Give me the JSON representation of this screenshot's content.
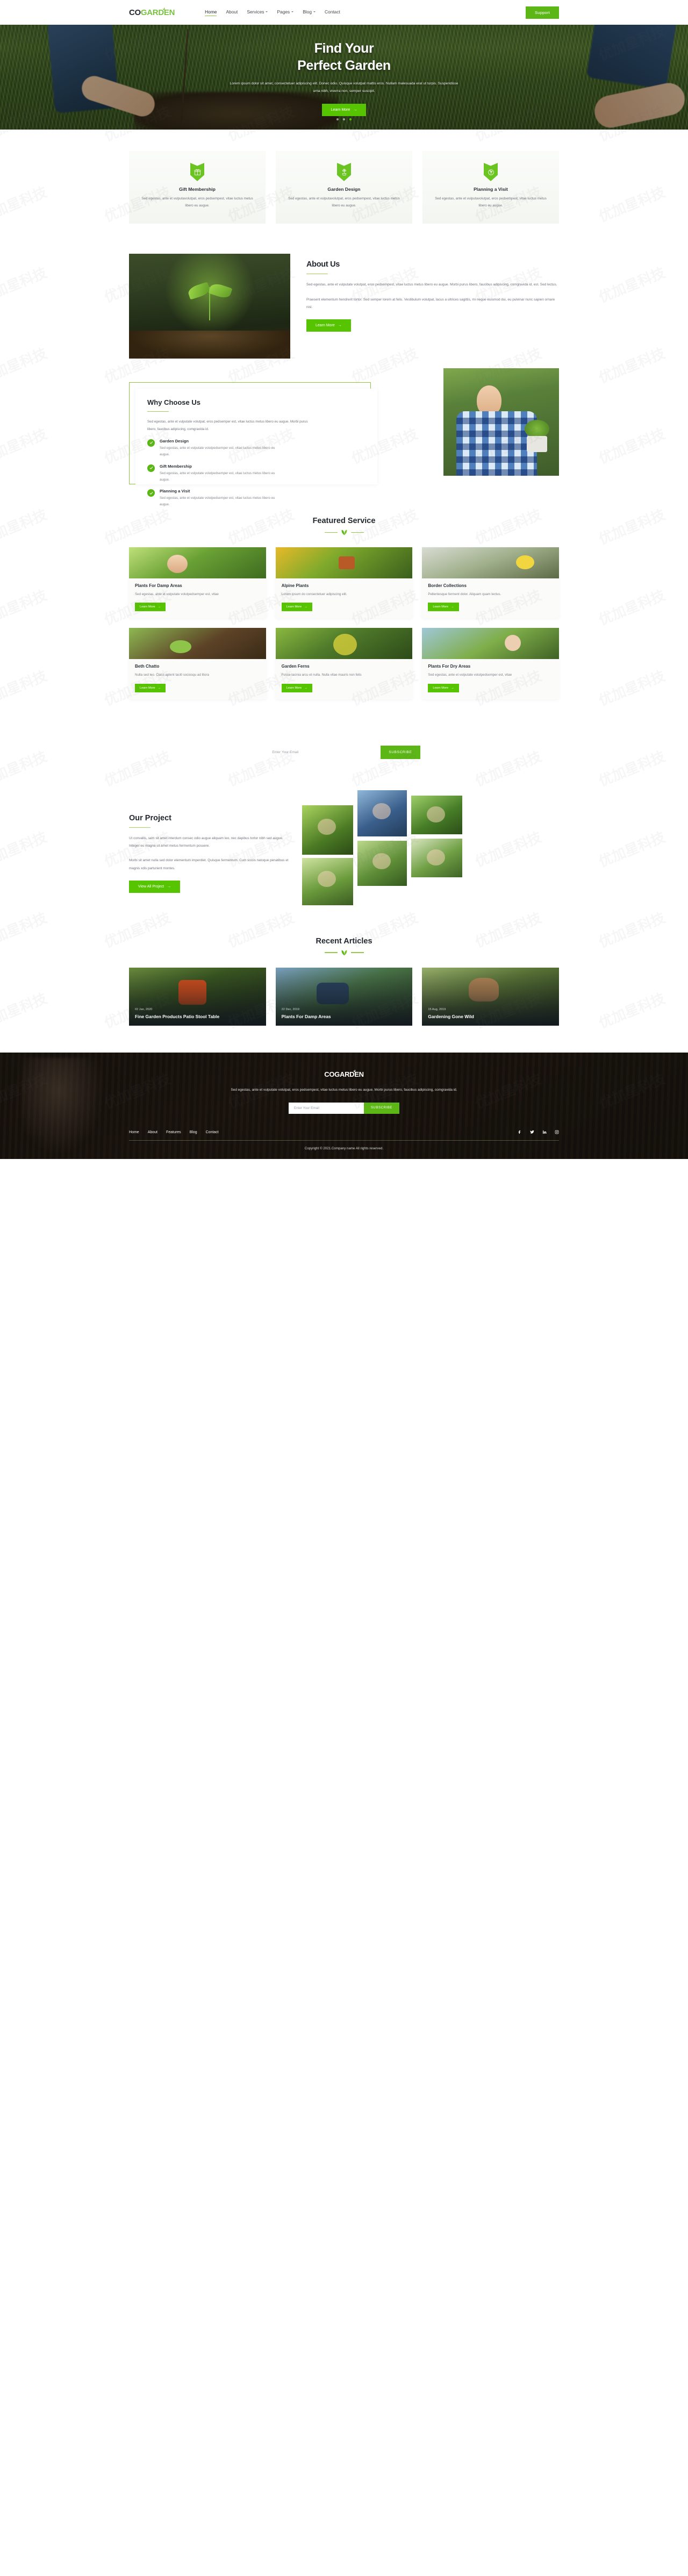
{
  "brand": {
    "part1": "CO",
    "part2": "GARDEN"
  },
  "header": {
    "nav": [
      {
        "label": "Home",
        "active": true,
        "caret": false
      },
      {
        "label": "About",
        "active": false,
        "caret": false
      },
      {
        "label": "Services",
        "active": false,
        "caret": true
      },
      {
        "label": "Pages",
        "active": false,
        "caret": true
      },
      {
        "label": "Blog",
        "active": false,
        "caret": true
      },
      {
        "label": "Contact",
        "active": false,
        "caret": false
      }
    ],
    "support_label": "Support"
  },
  "hero": {
    "title_line1": "Find Your",
    "title_line2": "Perfect Garden",
    "paragraph": "Lorem ipsum dolor sit amet, consectetuer adipiscing elit. Donec odio. Quisque volutpat mattis eros. Nullam malesuada erat ut turpis. Suspendisse urna nibh, viverra non, semper suscipit.",
    "cta_label": "Learn More",
    "slide_count": 3,
    "active_slide": 3
  },
  "services": [
    {
      "icon": "gift-icon",
      "title": "Gift Membership",
      "text": "Sed egestas, ante et vulputavolutpat, eros pedsempest, vitae luctus metus libero eu augue."
    },
    {
      "icon": "potted-plant-icon",
      "title": "Garden Design",
      "text": "Sed egestas, ante et vulputavolutpat, eros pedsempest, vitae luctus metus libero eu augue."
    },
    {
      "icon": "leaf-circle-icon",
      "title": "Planning a Visit",
      "text": "Sed egestas, ante et vulputavolutpat, eros pedsempest, vitae luctus metus libero eu augue."
    }
  ],
  "about": {
    "title": "About Us",
    "p1": "Sed egestas, ante et vulputate volutpat, eros pedsempest, vitae luctus metus libero eu augue. Morbi purus libero, faucibus adipiscing, comgravida id, est. Sed lectus.",
    "p2": "Praesent elementum hendrerit tortor. Sed semper lorem at felis. Vestibulum volutpat, lacus a ultrices sagittis, mi neque euismod dui, eu pulvinar nunc sapien ornare nisl.",
    "cta_label": "Learn More"
  },
  "why": {
    "title": "Why Choose Us",
    "intro": "Sed egestas, ante et vulputate volutpat, eros pedsemper est, vitae luctus metus libero eu augue. Morbi purus libero, faucibus adipiscing, comgravida id.",
    "items": [
      {
        "title": "Garden Design",
        "text": "Sed egestas, ante et vulputate volutpedsemper est, vitae luctus metus libero eu augue."
      },
      {
        "title": "Gift Membership",
        "text": "Sed egestas, ante et vulputate volutpedsemper est, vitae luctus metus libero eu augue."
      },
      {
        "title": "Planning a Visit",
        "text": "Sed egestas, ante et vulputate volutpedsemper est, vitae luctus metus libero eu augue."
      }
    ]
  },
  "featured": {
    "title": "Featured Service",
    "cards": [
      {
        "title": "Plants For Damp Areas",
        "text": "Sed egestas, ante et vulputate volutpedsemper est, vitae",
        "cta": "Learn More"
      },
      {
        "title": "Alpine Plants",
        "text": "Lorem ipsum do consectetuer adipiscing elit.",
        "cta": "Learn More"
      },
      {
        "title": "Border Collections",
        "text": "Pellentesque ferment dolor. Aliquam quam lectus.",
        "cta": "Learn More"
      },
      {
        "title": "Beth Chatto",
        "text": "Nulla sed leo. Class aptent taciti sociosqu ad litora",
        "cta": "Learn More"
      },
      {
        "title": "Garden Ferns",
        "text": "Fusce lacinia arcu et nulla. Nulla vitae mauris non felis",
        "cta": "Learn More"
      },
      {
        "title": "Plants For Dry Areas",
        "text": "Sed egestas, ante et vulputate volutpedsemper est, vitae",
        "cta": "Learn More"
      }
    ]
  },
  "newsletter_mid": {
    "placeholder": "Enter Your Email",
    "button_label": "SUBSCRIBE"
  },
  "project": {
    "title": "Our Project",
    "p1": "Ut convallis, sem sit amet interdum consec odio augue aliquam leo, nec dapibus tortor nibh sed augue. Integer eu magna sit amet metus fermentum posuere.",
    "p2": "Morbi sit amet nulla sed dolor elementum imperdiet. Quisque fermentum. Cum sociis natoque penatibus et magnis xdis parturient montes.",
    "cta_label": "View All Project"
  },
  "articles": {
    "title": "Recent Articles",
    "cards": [
      {
        "date": "02 Jan, 2020",
        "title": "Fine Garden Products Patio Stool Table"
      },
      {
        "date": "22 Dec, 2019",
        "title": "Plants For Damp Areas"
      },
      {
        "date": "15 Aug, 2019",
        "title": "Gardening Gone Wild"
      }
    ]
  },
  "footer": {
    "blurb": "Sed egestas, ante et vulputate volutpat, eros pedsempest, vitae luctus metus libero eu augue. Morbi purus libero, faucibus adipiscing, comgravida id.",
    "newsletter": {
      "placeholder": "Enter Your Email",
      "button_label": "SUBSCRIBE"
    },
    "nav": [
      {
        "label": "Home"
      },
      {
        "label": "About"
      },
      {
        "label": "Features"
      },
      {
        "label": "Blog"
      },
      {
        "label": "Contact"
      }
    ],
    "social": [
      "facebook-icon",
      "twitter-icon",
      "linkedin-icon",
      "instagram-icon"
    ],
    "copyright": "Copyright © 2021.Company name All rights reserved."
  },
  "colors": {
    "brand_green": "#7ac143",
    "accent_green": "#57c402",
    "button_green": "#5cb615",
    "dark_text": "#23272e",
    "body_text": "#70757d"
  }
}
